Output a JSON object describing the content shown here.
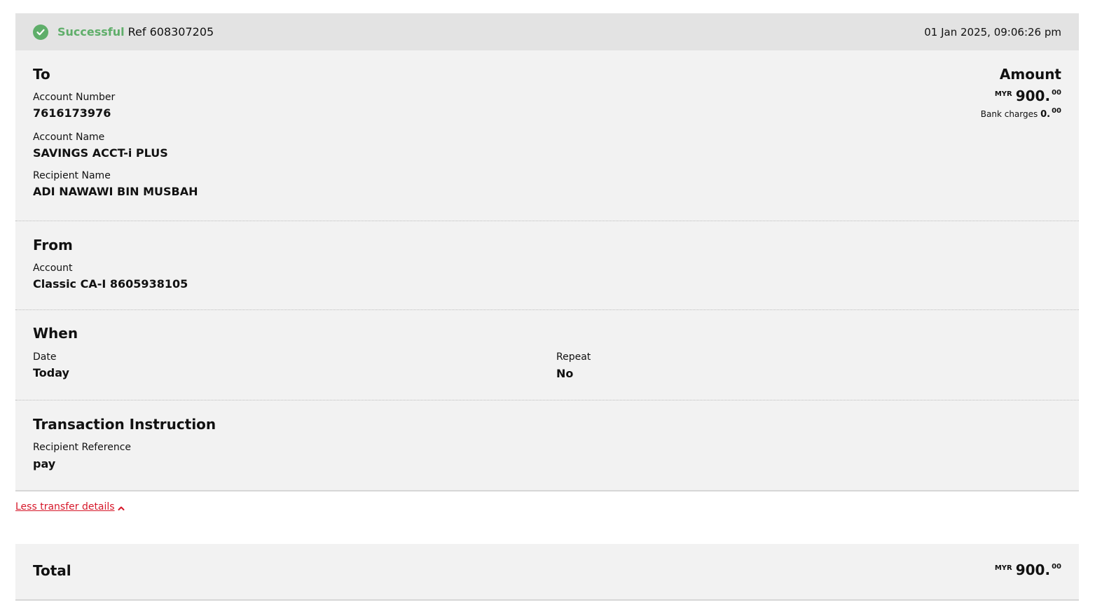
{
  "status": {
    "label": "Successful",
    "ref": "Ref 608307205",
    "timestamp": "01 Jan 2025, 09:06:26 pm",
    "icon": "check-circle-icon",
    "color": "#5fae6a"
  },
  "to": {
    "title": "To",
    "account_number_label": "Account Number",
    "account_number": "7616173976",
    "account_name_label": "Account Name",
    "account_name": "SAVINGS ACCT-i PLUS",
    "recipient_name_label": "Recipient Name",
    "recipient_name": "ADI NAWAWI BIN MUSBAH"
  },
  "amount": {
    "title": "Amount",
    "currency": "MYR",
    "whole": "900.",
    "cents": "00",
    "bank_charges_label": "Bank charges",
    "bank_charges_whole": "0.",
    "bank_charges_cents": "00"
  },
  "from": {
    "title": "From",
    "account_label": "Account",
    "account": "Classic CA-I 8605938105"
  },
  "when": {
    "title": "When",
    "date_label": "Date",
    "date": "Today",
    "repeat_label": "Repeat",
    "repeat": "No"
  },
  "instruction": {
    "title": "Transaction Instruction",
    "recipient_reference_label": "Recipient Reference",
    "recipient_reference": "pay"
  },
  "toggle": {
    "label": "Less transfer details",
    "icon": "chevron-up-icon",
    "color": "#d6182a"
  },
  "total": {
    "title": "Total",
    "currency": "MYR",
    "whole": "900.",
    "cents": "00"
  }
}
